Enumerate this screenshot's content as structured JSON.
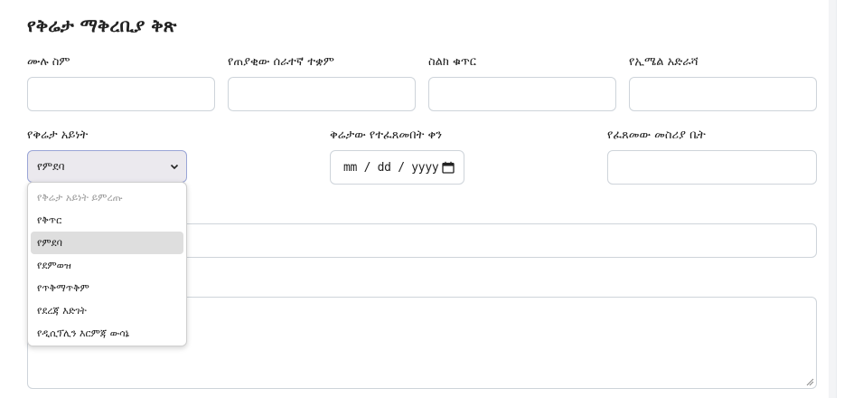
{
  "form": {
    "title": "የቅሬታ ማቅረቢያ ቅጽ",
    "fields": {
      "full_name": {
        "label": "ሙሉ ስም",
        "value": ""
      },
      "employee_position": {
        "label": "የጠያቂው ሰራተኛ ተቋም",
        "value": ""
      },
      "phone": {
        "label": "ስልክ ቁጥር",
        "value": ""
      },
      "email": {
        "label": "የኢሜል አድራሻ",
        "value": ""
      },
      "complaint_type": {
        "label": "የቅሬታ አይነት",
        "selected": "የምደባ",
        "options": [
          "የቅሬታ አይነት ይምረጡ",
          "የቅጥር",
          "የምደባ",
          "የደምወዝ",
          "የጥቅማጥቅም",
          "የደረጃ እድገት",
          "የዲሲፕሊን እርምጃ ውሳኔ"
        ]
      },
      "complaint_date": {
        "label": "ቅሬታው የተፈጸመበት ቀን",
        "placeholder": "mm / dd / yyyy"
      },
      "office": {
        "label": "የፈጸመው መስሪያ ቤት",
        "value": ""
      },
      "subject": {
        "value": ""
      },
      "details": {
        "value": ""
      }
    }
  },
  "colors": {
    "select_bg": "#ebe9ee",
    "select_border": "#9aa5d6",
    "field_border": "#ced4da",
    "highlight": "#dedede"
  },
  "icons": {
    "select_chevron": "chevron-down-icon",
    "date_picker": "calendar-icon",
    "textarea_grip": "resize-grip-icon"
  }
}
